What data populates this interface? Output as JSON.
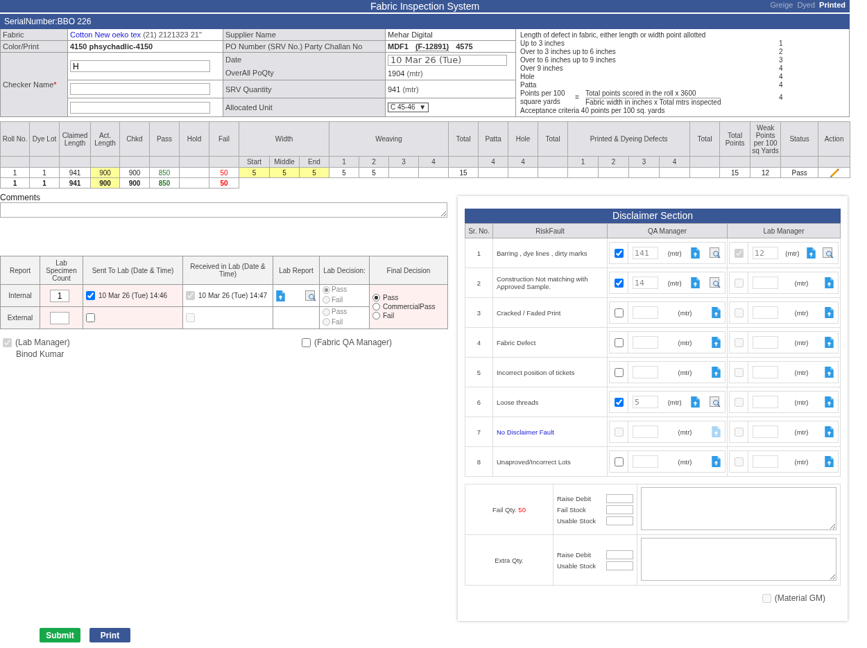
{
  "header": {
    "title": "Fabric Inspection System",
    "tabs": [
      {
        "label": "Greige",
        "selected": false
      },
      {
        "label": "Dyed",
        "selected": false
      },
      {
        "label": "Printed",
        "selected": true
      }
    ]
  },
  "serial": "SerialNumber:BBO 226",
  "info": {
    "fabric": {
      "label": "Fabric",
      "link": "Cotton New oeko tex",
      "detail": "(21) 2121323 21\""
    },
    "supplier": {
      "label": "Supplier Name",
      "value": "Mehar Digital"
    },
    "color": {
      "label": "Color/Print",
      "value": "4150 phsychadlic-4150"
    },
    "po": {
      "label": "PO Number (SRV No.) Party Challan No",
      "parts": [
        "MDF1",
        "(F-12891)",
        "4575"
      ]
    },
    "checker": {
      "label": "Checker Name",
      "required_mark": "*",
      "inputs": [
        {
          "kind": "filled",
          "value": "H"
        },
        {
          "kind": "blank"
        },
        {
          "kind": "blank"
        }
      ]
    },
    "date": {
      "label": "Date",
      "value": "10 Mar 26 (Tue)"
    },
    "po_qty": {
      "label": "OverAll PoQty",
      "value": "1904",
      "unit": "(mtr)"
    },
    "srv_qty": {
      "label": "SRV Quantity",
      "value": "941",
      "unit": "(mtr)"
    },
    "unit": {
      "label": "Allocated Unit",
      "value": "C 45-46",
      "caret": "▼"
    }
  },
  "points": {
    "title": "Length of defect in fabric, either length or width point allotted",
    "rules": [
      {
        "label": "Up to 3 inches",
        "points": "1"
      },
      {
        "label": "Over to 3 inches up to 6 inches",
        "points": "2"
      },
      {
        "label": "Over to 6 inches up to 9 inches",
        "points": "3"
      },
      {
        "label": "Over 9 inches",
        "points": "4"
      },
      {
        "label": "Hole",
        "points": "4"
      },
      {
        "label": "Patta",
        "points": "4"
      }
    ],
    "formula": {
      "label": "Points per 100 square yards",
      "eq": "=",
      "numerator": "Total points scored in the roll x 3600",
      "denominator": "Fabric width in inches x Total mtrs inspected",
      "points": "4"
    },
    "acceptance": "Acceptance criteria 40 points per 100 sq. yards"
  },
  "inspection": {
    "headers": [
      {
        "label": "Roll No."
      },
      {
        "label": "Dye Lot"
      },
      {
        "label": "Claimed Length"
      },
      {
        "label": "Act. Length",
        "highlight": true
      },
      {
        "label": "Chkd"
      },
      {
        "label": "Pass"
      },
      {
        "label": "Hold"
      },
      {
        "label": "Fail"
      },
      {
        "label": "Width",
        "subs": [
          "Start",
          "Middle",
          "End"
        ],
        "highlight": true
      },
      {
        "label": "Weaving",
        "subs": [
          "1",
          "2",
          "3",
          "4"
        ]
      },
      {
        "label": "Total"
      },
      {
        "label": "Patta",
        "subs": [
          "4"
        ]
      },
      {
        "label": "Hole",
        "subs": [
          "4"
        ]
      },
      {
        "label": "Total"
      },
      {
        "label": "Printed & Dyeing Defects",
        "subs": [
          "1",
          "2",
          "3",
          "4"
        ]
      },
      {
        "label": "Total"
      },
      {
        "label": "Total Points"
      },
      {
        "label": "Weak Points per 100 sq Yards"
      },
      {
        "label": "Status"
      },
      {
        "label": "Action"
      }
    ],
    "rows": [
      {
        "kind": "roll",
        "editable": true,
        "cells": [
          "1",
          "1",
          "941",
          "900",
          "900",
          "850",
          null,
          "50",
          "5",
          "5",
          "5",
          "5",
          "5",
          null,
          null,
          "15",
          null,
          null,
          null,
          null,
          null,
          null,
          null,
          null,
          "15",
          "12",
          "Pass"
        ]
      },
      {
        "kind": "total",
        "cells": [
          "1",
          "1",
          "941",
          "900",
          "900",
          "850",
          null,
          "50"
        ]
      }
    ]
  },
  "comments": {
    "label": "Comments"
  },
  "lab": {
    "headers": [
      "Report",
      "Lab Specimen Count",
      "Sent To Lab (Date & Time)",
      "Received in Lab (Date & Time)",
      "Lab Report",
      "Lab Decision:",
      "Final Decision"
    ],
    "rows": [
      {
        "label": "Internal",
        "count": "1",
        "sent": {
          "checked": true,
          "disabled": false,
          "text": "10 Mar 26 (Tue) 14:46"
        },
        "received": {
          "checked": true,
          "disabled": true,
          "text": "10 Mar 26 (Tue) 14:47"
        },
        "report": true,
        "decision": {
          "disabled": true,
          "options": [
            {
              "label": "Pass",
              "selected": true
            },
            {
              "label": "Fail",
              "selected": false
            }
          ]
        }
      },
      {
        "label": "External",
        "sent": {
          "checked": false,
          "disabled": false
        },
        "received": {
          "checked": false,
          "disabled": true
        },
        "report": false,
        "decision": {
          "disabled": true,
          "options": [
            {
              "label": "Pass",
              "selected": false
            },
            {
              "label": "Fail",
              "selected": false
            }
          ]
        }
      }
    ],
    "final": {
      "options": [
        {
          "label": "Pass",
          "selected": true
        },
        {
          "label": "CommercialPass",
          "selected": false
        },
        {
          "label": "Fail",
          "selected": false
        }
      ]
    }
  },
  "signoffs": [
    {
      "label": "(Lab Manager)",
      "checked": true,
      "disabled": true,
      "name": "Binod Kumar"
    },
    {
      "label": "(Fabric QA Manager)",
      "checked": false,
      "disabled": false
    }
  ],
  "disclaimer": {
    "title": "Disclaimer Section",
    "headers": [
      "Sr. No.",
      "RiskFault",
      "QA Manager",
      "Lab Manager"
    ],
    "rows": [
      {
        "no": "1",
        "fault": "Barring , dye lines , dirty marks",
        "qa": {
          "checked": true,
          "disabled": false,
          "value": "141",
          "unit": "(mtr)",
          "preview": true,
          "upload_disabled": false
        },
        "lab": {
          "checked": true,
          "disabled": true,
          "value": "12",
          "unit": "(mtr)",
          "preview": true,
          "upload_disabled": false
        }
      },
      {
        "no": "2",
        "fault": "Construction Not matching with Approved Sample.",
        "qa": {
          "checked": true,
          "disabled": false,
          "value": "14",
          "unit": "(mtr)",
          "preview": true,
          "upload_disabled": false
        },
        "lab": {
          "checked": false,
          "disabled": true,
          "unit": "(mtr)",
          "preview": false,
          "upload_disabled": false
        }
      },
      {
        "no": "3",
        "fault": "Cracked / Faded Print",
        "qa": {
          "checked": false,
          "disabled": false,
          "unit": "(mtr)",
          "preview": false,
          "upload_disabled": false
        },
        "lab": {
          "checked": false,
          "disabled": true,
          "unit": "(mtr)",
          "preview": false,
          "upload_disabled": false
        }
      },
      {
        "no": "4",
        "fault": "Fabric Defect",
        "qa": {
          "checked": false,
          "disabled": false,
          "unit": "(mtr)",
          "preview": false,
          "upload_disabled": false
        },
        "lab": {
          "checked": false,
          "disabled": true,
          "unit": "(mtr)",
          "preview": false,
          "upload_disabled": false
        }
      },
      {
        "no": "5",
        "fault": "Incorrect position of tickets",
        "qa": {
          "checked": false,
          "disabled": false,
          "unit": "(mtr)",
          "preview": false,
          "upload_disabled": false
        },
        "lab": {
          "checked": false,
          "disabled": true,
          "unit": "(mtr)",
          "preview": false,
          "upload_disabled": false
        }
      },
      {
        "no": "6",
        "fault": "Loose threads",
        "qa": {
          "checked": true,
          "disabled": false,
          "value": "5",
          "unit": "(mtr)",
          "preview": true,
          "upload_disabled": false
        },
        "lab": {
          "checked": false,
          "disabled": true,
          "unit": "(mtr)",
          "preview": false,
          "upload_disabled": false
        }
      },
      {
        "no": "7",
        "kind": "link",
        "fault": "No Disclaimer Fault",
        "qa": {
          "checked": false,
          "disabled": true,
          "unit": "(mtr)",
          "preview": false,
          "upload_disabled": true
        },
        "lab": {
          "checked": false,
          "disabled": true,
          "unit": "(mtr)",
          "preview": false,
          "upload_disabled": false
        }
      },
      {
        "no": "8",
        "fault": "Unaproved/Incorrect Lots",
        "qa": {
          "checked": false,
          "disabled": false,
          "unit": "(mtr)",
          "preview": false,
          "upload_disabled": false
        },
        "lab": {
          "checked": false,
          "disabled": true,
          "unit": "(mtr)",
          "preview": false,
          "upload_disabled": false
        }
      }
    ]
  },
  "quantities": [
    {
      "label": "Fail Qty.",
      "value": "50",
      "fields": [
        "Raise Debit",
        "Fail Stock",
        "Usable Stock"
      ]
    },
    {
      "label": "Extra Qty.",
      "fields": [
        "Raise Debit",
        "Usable Stock"
      ]
    }
  ],
  "material_gm": {
    "label": "(Material GM)",
    "checked": false,
    "disabled": true
  },
  "buttons": [
    {
      "label": "Submit",
      "kind": "success"
    },
    {
      "label": "Print",
      "kind": "primary"
    }
  ]
}
